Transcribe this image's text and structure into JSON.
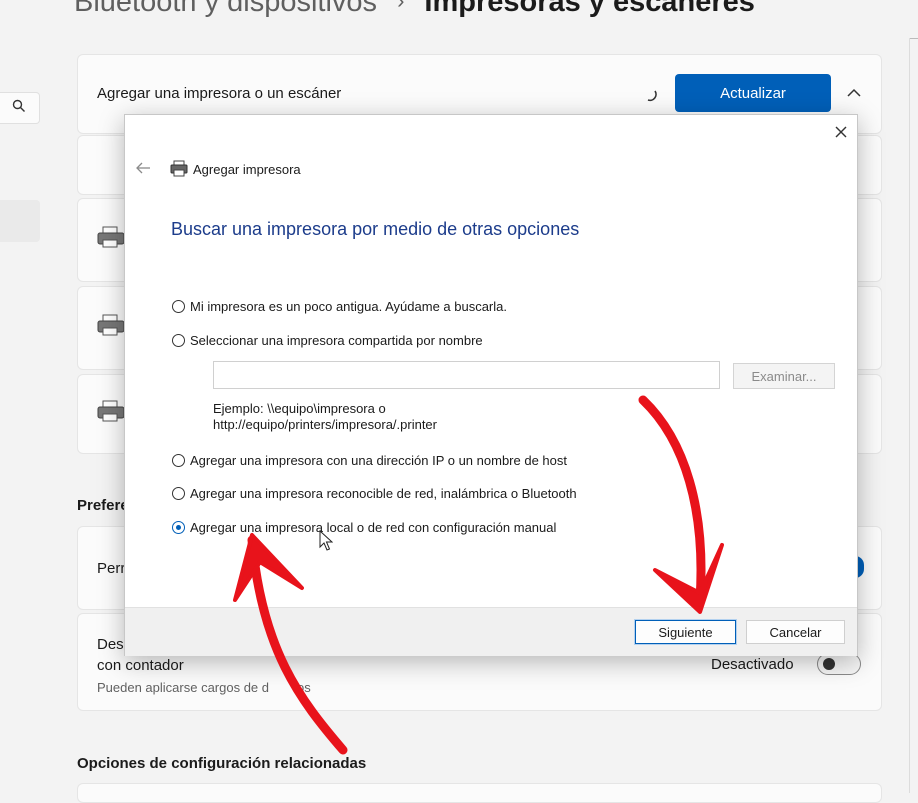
{
  "breadcrumb": {
    "parent": "Bluetooth y dispositivos",
    "separator": "›",
    "current": "Impresoras y escáneres"
  },
  "add_row": {
    "label": "Agregar una impresora o un escáner",
    "refresh_label": "Actualizar",
    "collapse_icon": "chevron-up-icon"
  },
  "preferences": {
    "section_partial": "Prefere",
    "row1_partial": "Perr",
    "row2_line1_partial": "Des",
    "row2_line2": "con contador",
    "row2_sub_partial": "Pueden aplicarse cargos de d",
    "row2_sub_end": "os",
    "toggle_label": "Desactivado"
  },
  "related_section": "Opciones de configuración relacionadas",
  "dialog": {
    "title": "Agregar impresora",
    "heading": "Buscar una impresora por medio de otras opciones",
    "options": [
      {
        "label": "Mi impresora es un poco antigua. Ayúdame a buscarla.",
        "checked": false
      },
      {
        "label": "Seleccionar una impresora compartida por nombre",
        "checked": false
      },
      {
        "label": "Agregar una impresora con una dirección IP o un nombre de host",
        "checked": false
      },
      {
        "label": "Agregar una impresora reconocible de red, inalámbrica o Bluetooth",
        "checked": false
      },
      {
        "label": "Agregar una impresora local o de red con configuración manual",
        "checked": true
      }
    ],
    "name_input_value": "",
    "browse_label": "Examinar...",
    "example_line1": "Ejemplo: \\\\equipo\\impresora o",
    "example_line2": "http://equipo/printers/impresora/.printer",
    "next_label": "Siguiente",
    "cancel_label": "Cancelar"
  },
  "colors": {
    "accent": "#005fb8",
    "heading": "#1c3c8b",
    "annotation": "#e8131b"
  }
}
